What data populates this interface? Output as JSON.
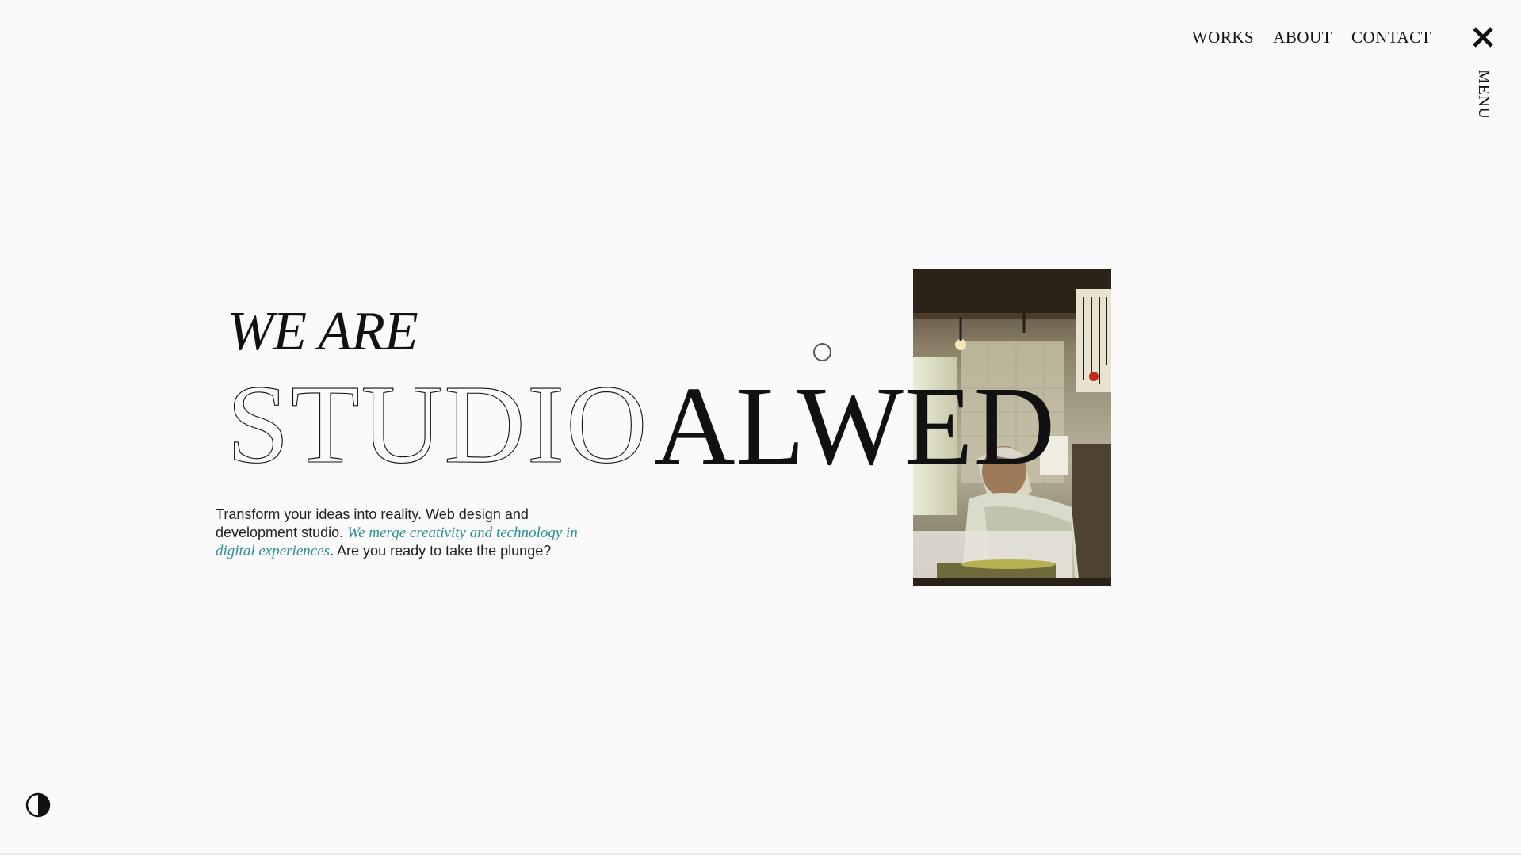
{
  "nav": {
    "items": [
      {
        "label": "WORKS"
      },
      {
        "label": "ABOUT"
      },
      {
        "label": "CONTACT"
      }
    ],
    "close_icon": "close-icon",
    "menu_label": "MENU"
  },
  "hero": {
    "eyebrow": "WE ARE",
    "title_outline": "STUDIO",
    "title_solid": "ALWED",
    "intro_part1": "Transform your ideas into reality. Web design and development studio. ",
    "intro_accent": "We merge creativity and technology in digital experiences",
    "intro_part2": ". Are you ready to take the plunge?",
    "photo": "photo of an elderly man working at a counter in a small shop"
  },
  "colors": {
    "background": "#fafafa",
    "text": "#111111",
    "accent": "#2a8f96"
  },
  "footer": {
    "theme_toggle_icon": "contrast-icon"
  }
}
